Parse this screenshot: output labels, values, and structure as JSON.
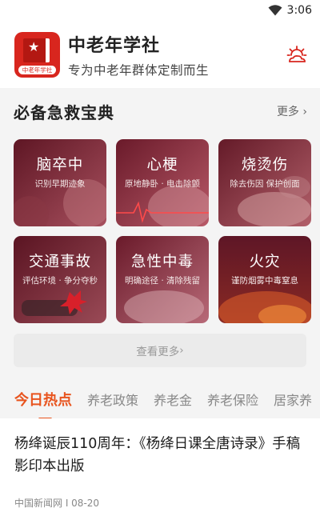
{
  "status_bar": {
    "time": "3:06"
  },
  "app": {
    "name": "中老年学社",
    "slogan": "专为中老年群体定制而生",
    "logo_text": "中老年学社"
  },
  "first_aid": {
    "title": "必备急救宝典",
    "more_label": "更多",
    "see_more_label": "查看更多",
    "items": [
      {
        "title": "脑卒中",
        "subtitle": "识别早期迹象"
      },
      {
        "title": "心梗",
        "subtitle": "原地静卧 · 电击除颤"
      },
      {
        "title": "烧烫伤",
        "subtitle": "除去伤因 保护创面"
      },
      {
        "title": "交通事故",
        "subtitle": "评估环境 · 争分夺秒"
      },
      {
        "title": "急性中毒",
        "subtitle": "明确途径 · 清除残留"
      },
      {
        "title": "火灾",
        "subtitle": "谨防烟雾中毒窒息"
      }
    ]
  },
  "news_tabs": [
    {
      "label": "今日热点",
      "active": true
    },
    {
      "label": "养老政策",
      "active": false
    },
    {
      "label": "养老金",
      "active": false
    },
    {
      "label": "养老保险",
      "active": false
    },
    {
      "label": "居家养",
      "active": false
    }
  ],
  "article": {
    "headline": "杨绛诞辰110周年：《杨绛日课全唐诗录》手稿影印本出版",
    "source": "中国新闻网 I 08-20"
  },
  "colors": {
    "accent": "#e8541e",
    "logo_red": "#d8261e",
    "tile_dark": "#6a1e2a",
    "tile_light": "#b04a58"
  },
  "icons": {
    "wifi": "wifi-icon",
    "weather": "sun-cloud-icon",
    "chevron": "chevron-right-icon"
  }
}
